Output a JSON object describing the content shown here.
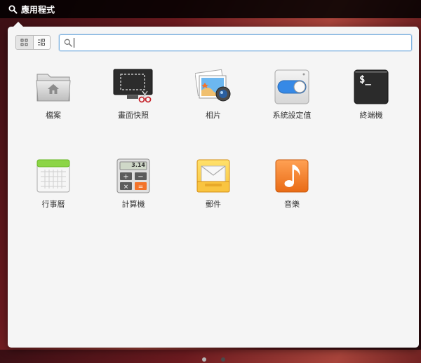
{
  "panel": {
    "app_menu_label": "應用程式",
    "app_menu_icon": "search-icon"
  },
  "launcher": {
    "view_modes": [
      "grid-view-icon",
      "category-view-icon"
    ],
    "active_view": "grid",
    "search": {
      "value": "",
      "placeholder": ""
    },
    "apps": [
      {
        "label": "檔案",
        "icon": "folder-icon"
      },
      {
        "label": "畫面快照",
        "icon": "screenshot-icon"
      },
      {
        "label": "相片",
        "icon": "photos-icon"
      },
      {
        "label": "系統設定值",
        "icon": "settings-toggle-icon"
      },
      {
        "label": "終端機",
        "icon": "terminal-icon"
      },
      {
        "label": "行事曆",
        "icon": "calendar-icon"
      },
      {
        "label": "計算機",
        "icon": "calculator-icon"
      },
      {
        "label": "郵件",
        "icon": "mail-icon"
      },
      {
        "label": "音樂",
        "icon": "music-icon"
      }
    ],
    "calculator_display": "3.14",
    "terminal_prompt": "$_",
    "pages": {
      "count": 2,
      "current": 2
    }
  },
  "colors": {
    "accent": "#3689e6",
    "music": "#f37329",
    "calendar_header": "#8cd546"
  }
}
